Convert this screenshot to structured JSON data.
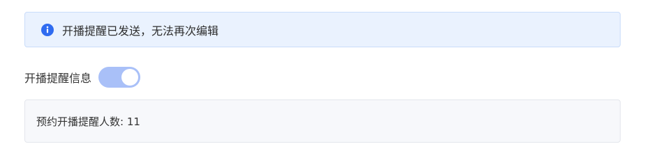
{
  "alert": {
    "icon": "info-icon",
    "message": "开播提醒已发送，无法再次编辑"
  },
  "reminder_toggle": {
    "label": "开播提醒信息",
    "state": "on",
    "enabled": false
  },
  "reservation": {
    "text": "预约开播提醒人数: 11",
    "count": 11
  },
  "colors": {
    "alert_bg": "#eaf2fe",
    "accent": "#2f6bf0",
    "switch_disabled_on": "#a9c0f8"
  }
}
